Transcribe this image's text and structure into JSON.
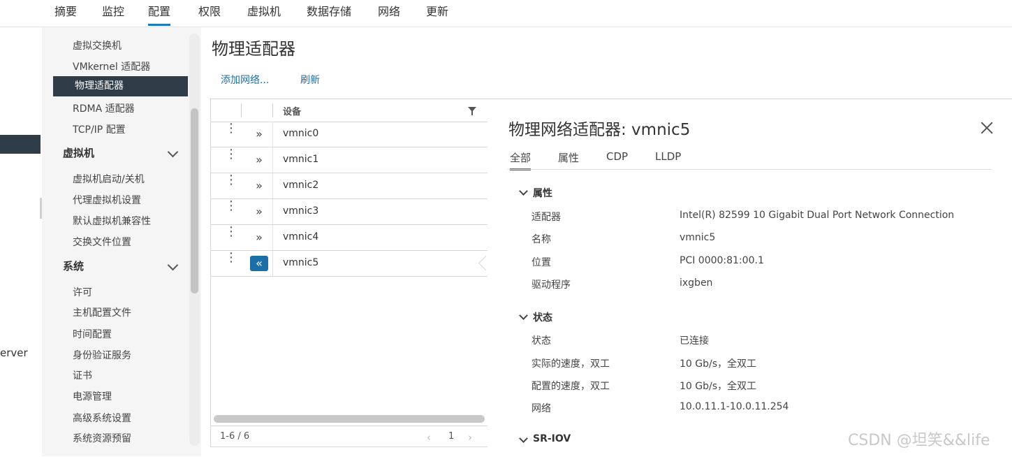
{
  "left_pane": {
    "partial_text": "erver"
  },
  "top_tabs": [
    "摘要",
    "监控",
    "配置",
    "权限",
    "虚拟机",
    "数据存储",
    "网络",
    "更新"
  ],
  "nav": {
    "items_top": [
      "虚拟交换机",
      "VMkernel 适配器",
      "物理适配器",
      "RDMA 适配器",
      "TCP/IP 配置"
    ],
    "group_vm": "虚拟机",
    "items_vm": [
      "虚拟机启动/关机",
      "代理虚拟机设置",
      "默认虚拟机兼容性",
      "交换文件位置"
    ],
    "group_system": "系统",
    "items_system": [
      "许可",
      "主机配置文件",
      "时间配置",
      "身份验证服务",
      "证书",
      "电源管理",
      "高级系统设置",
      "系统资源预留"
    ]
  },
  "page": {
    "title": "物理适配器",
    "add_network": "添加网络...",
    "refresh": "刷新"
  },
  "grid": {
    "header_device": "设备",
    "rows": [
      "vmnic0",
      "vmnic1",
      "vmnic2",
      "vmnic3",
      "vmnic4",
      "vmnic5"
    ],
    "selected_row": "vmnic5",
    "footer_count": "1-6 / 6",
    "page": "1"
  },
  "detail": {
    "title": "物理网络适配器: vmnic5",
    "tabs": [
      "全部",
      "属性",
      "CDP",
      "LLDP"
    ],
    "section_props": "属性",
    "props": [
      {
        "k": "适配器",
        "v": "Intel(R) 82599 10 Gigabit Dual Port Network Connection"
      },
      {
        "k": "名称",
        "v": "vmnic5"
      },
      {
        "k": "位置",
        "v": "PCI 0000:81:00.1"
      },
      {
        "k": "驱动程序",
        "v": "ixgben"
      }
    ],
    "section_status": "状态",
    "status": [
      {
        "k": "状态",
        "v": "已连接"
      },
      {
        "k": "实际的速度，双工",
        "v": "10 Gb/s，全双工"
      },
      {
        "k": "配置的速度，双工",
        "v": "10 Gb/s，全双工"
      },
      {
        "k": "网络",
        "v": "10.0.11.1-10.0.11.254"
      }
    ],
    "section_sriov": "SR-IOV"
  },
  "watermark": "CSDN @坦笑&&life",
  "colors": {
    "accent": "#1b7bbf",
    "selected_nav": "#2f3d48",
    "link": "#1d6fa5"
  }
}
